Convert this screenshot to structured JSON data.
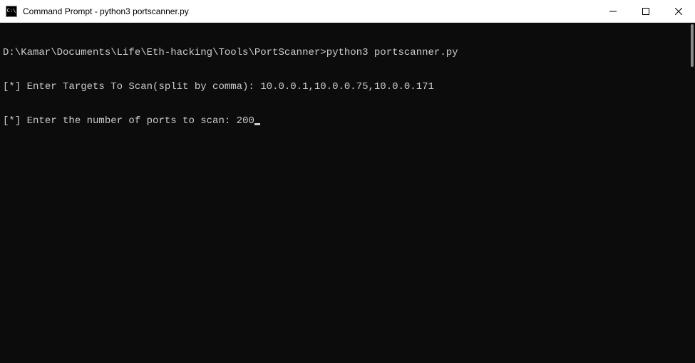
{
  "titlebar": {
    "title": "Command Prompt - python3  portscanner.py"
  },
  "terminal": {
    "prompt_path": "D:\\Kamar\\Documents\\Life\\Eth-hacking\\Tools\\PortScanner>",
    "command": "python3 portscanner.py",
    "line1_prefix": "[*] ",
    "line1_prompt": "Enter Targets To Scan(split by comma): ",
    "line1_input": "10.0.0.1,10.0.0.75,10.0.0.171",
    "line2_prefix": "[*] ",
    "line2_prompt": "Enter the number of ports to scan: ",
    "line2_input": "200"
  },
  "icons": {
    "minimize": "minimize",
    "maximize": "maximize",
    "close": "close"
  }
}
